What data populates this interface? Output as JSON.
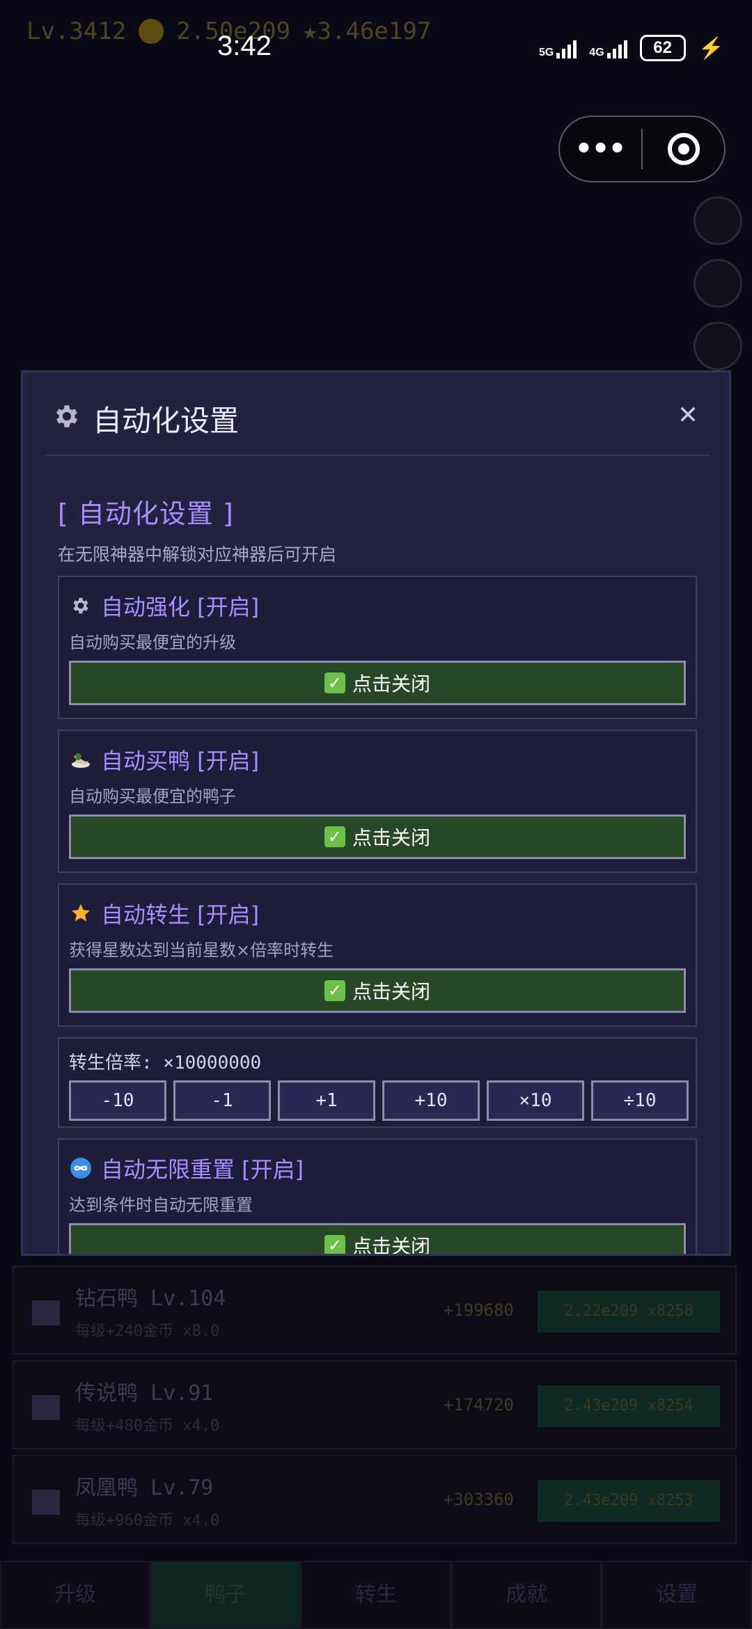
{
  "status_bar": {
    "time": "3:42",
    "network_1": "5G",
    "network_2": "4G",
    "battery": "62"
  },
  "background": {
    "level": "Lv.3412",
    "coins": "2.50e209",
    "stars": "★3.46e197",
    "duck_rows": [
      {
        "name": "钻石鸭 Lv.104",
        "sub": "每级+240金币 x8.0",
        "income": "+199680",
        "buy": "2.22e209 x8258"
      },
      {
        "name": "传说鸭 Lv.91",
        "sub": "每级+480金币 x4.0",
        "income": "+174720",
        "buy": "2.43e209 x8254"
      },
      {
        "name": "凤凰鸭 Lv.79",
        "sub": "每级+960金币 x4.0",
        "income": "+303360",
        "buy": "2.43e209 x8253"
      }
    ],
    "tabs": [
      "升级",
      "鸭子",
      "转生",
      "成就",
      "设置"
    ]
  },
  "modal": {
    "title": "自动化设置",
    "close_symbol": "✕",
    "section_title": "[ 自动化设置 ]",
    "section_hint": "在无限神器中解锁对应神器后可开启",
    "cards": [
      {
        "icon": "gear-icon",
        "title": "自动强化 [开启]",
        "desc": "自动购买最便宜的升级",
        "button": "点击关闭"
      },
      {
        "icon": "duck-icon",
        "title": "自动买鸭 [开启]",
        "desc": "自动购买最便宜的鸭子",
        "button": "点击关闭"
      },
      {
        "icon": "star-icon",
        "title": "自动转生 [开启]",
        "desc": "获得星数达到当前星数×倍率时转生",
        "button": "点击关闭"
      },
      {
        "icon": "infinity-icon",
        "title": "自动无限重置 [开启]",
        "desc": "达到条件时自动无限重置",
        "button": "点击关闭"
      }
    ],
    "rate": {
      "label": "转生倍率: ×10000000",
      "buttons": [
        "-10",
        "-1",
        "+1",
        "+10",
        "×10",
        "÷10"
      ]
    }
  },
  "colors": {
    "accent": "#a98cff",
    "modal_bg": "#22213f",
    "button_green": "#264826",
    "check_green": "#6cc04a",
    "star_yellow": "#f5b22a",
    "infinity_blue": "#3a8ee6"
  }
}
